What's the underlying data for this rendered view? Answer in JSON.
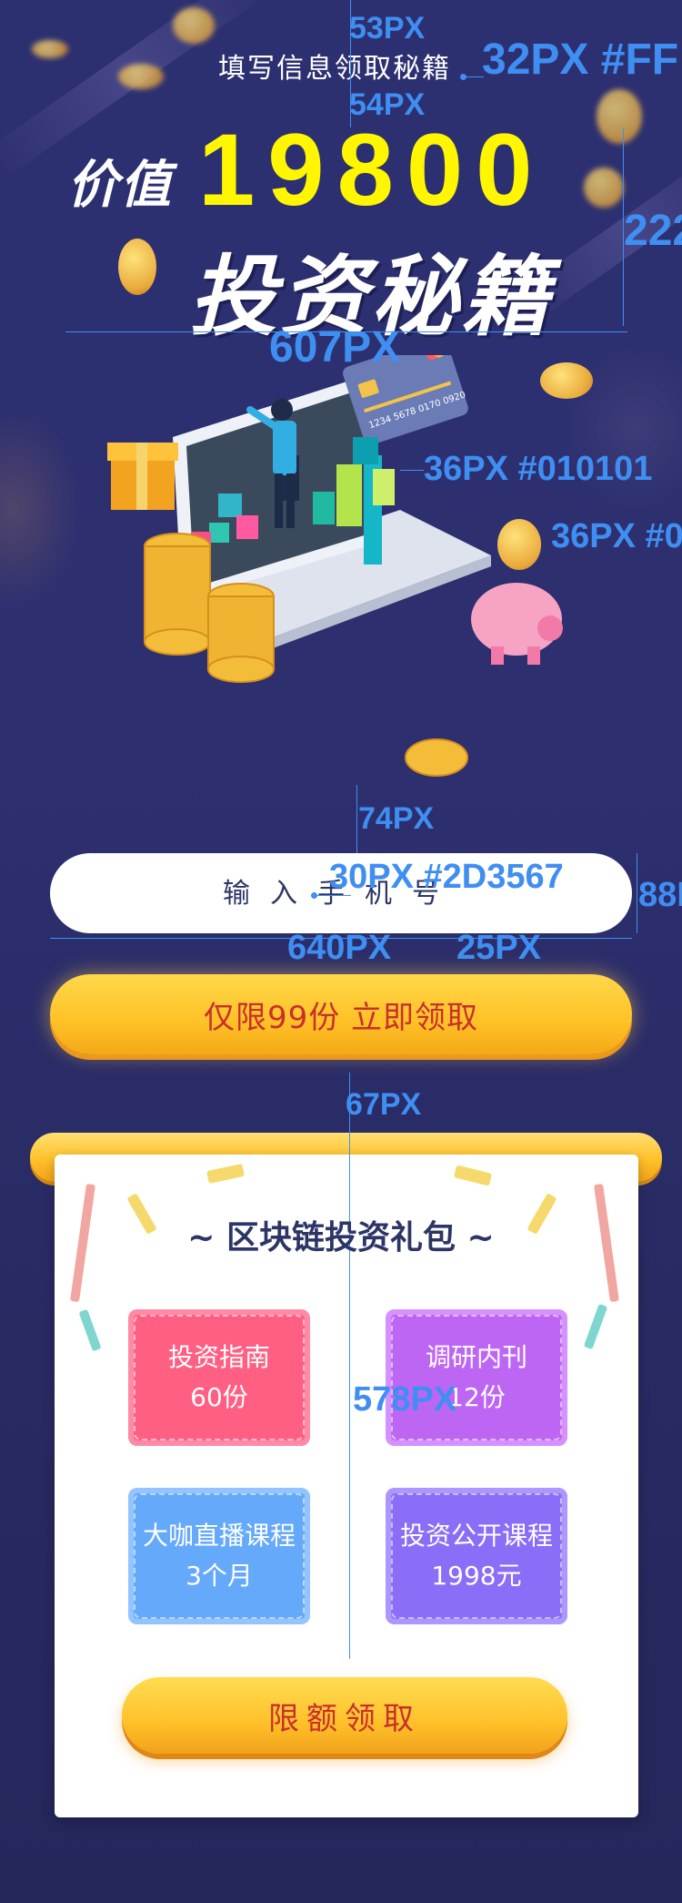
{
  "header": {
    "subtitle": "填写信息领取秘籍",
    "title_prefix": "价值",
    "title_number": "19800",
    "title_main": "投资秘籍"
  },
  "illustration": {
    "card_number": "1234 5678 0170 0920"
  },
  "annotations": {
    "d_53": "53PX",
    "d_32": "32PX #FF",
    "d_54": "54PX",
    "d_222": "222",
    "d_607": "607PX",
    "d_36a": "36PX #010101",
    "d_36b": "36PX #0",
    "d_74": "74PX",
    "d_30": "30PX #2D3567",
    "d_88": "88P",
    "d_640": "640PX",
    "d_25": "25PX",
    "d_67": "67PX",
    "d_578": "578PX"
  },
  "form": {
    "phone_placeholder": "输入手机号",
    "claim_button": "仅限99份  立即领取"
  },
  "gift_panel": {
    "title": "~ 区块链投资礼包 ~",
    "cards": [
      {
        "name": "投资指南",
        "value": "60份",
        "color": "#ff5f83"
      },
      {
        "name": "调研内刊",
        "value": "12份",
        "color": "#be66f4"
      },
      {
        "name": "大咖直播课程",
        "value": "3个月",
        "color": "#65a9fb"
      },
      {
        "name": "投资公开课程",
        "value": "1998元",
        "color": "#8a6ef8"
      }
    ],
    "limit_button": "限额领取"
  },
  "colors": {
    "background": "#2d3070",
    "accent_yellow": "#fff600",
    "button_gold": "#ffc126",
    "button_text": "#c8302b",
    "annotation_blue": "#3f8ef2",
    "input_text": "#2d3567"
  }
}
